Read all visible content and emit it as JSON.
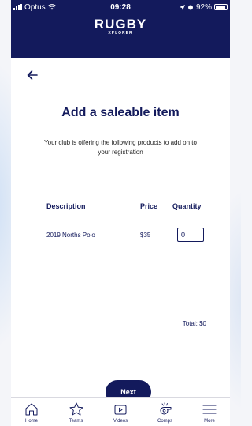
{
  "status_bar": {
    "carrier": "Optus",
    "time": "09:28",
    "battery": "92%"
  },
  "header": {
    "logo_main": "RUGBY",
    "logo_sub": "XPLORER"
  },
  "page": {
    "title": "Add a saleable item",
    "subtitle": "Your club is offering the following products to add on to your registration"
  },
  "table": {
    "headers": {
      "description": "Description",
      "price": "Price",
      "quantity": "Quantity"
    },
    "rows": [
      {
        "description": "2019 Norths Polo",
        "price": "$35",
        "quantity": "0"
      }
    ],
    "total": "Total: $0"
  },
  "actions": {
    "next_label": "Next"
  },
  "tabbar": {
    "items": [
      {
        "label": "Home",
        "icon": "home-icon"
      },
      {
        "label": "Teams",
        "icon": "star-icon"
      },
      {
        "label": "Videos",
        "icon": "play-icon"
      },
      {
        "label": "Comps",
        "icon": "whistle-icon"
      },
      {
        "label": "More",
        "icon": "menu-icon"
      }
    ]
  },
  "colors": {
    "primary": "#131a5c",
    "background": "#ffffff"
  }
}
